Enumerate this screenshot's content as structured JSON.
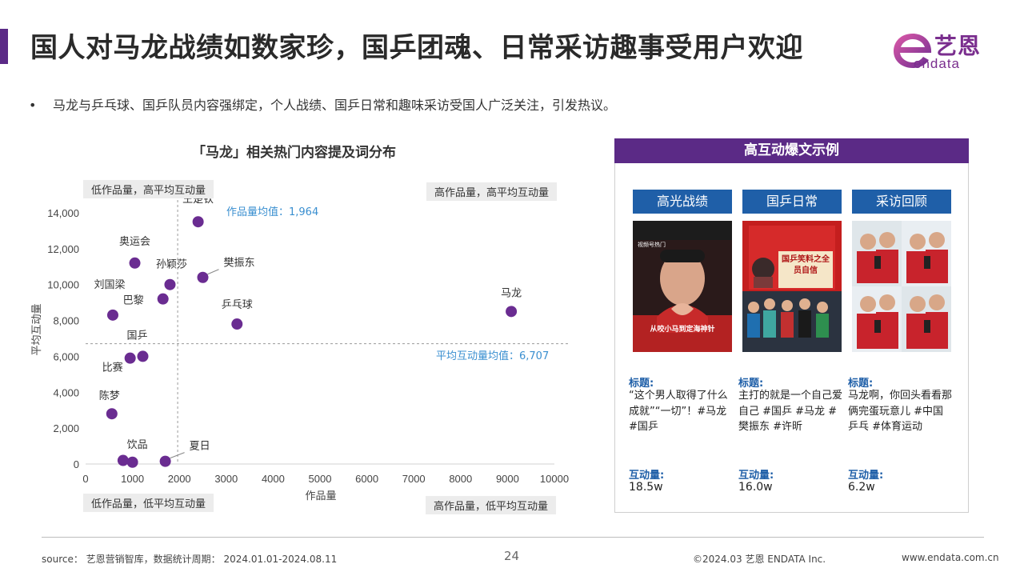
{
  "title": "国人对马龙战绩如数家珍，国乒团魂、日常采访趣事受用户欢迎",
  "logo": {
    "cn": "艺恩",
    "en": "endata"
  },
  "bullet": "马龙与乒乓球、国乒队员内容强绑定，个人战绩、国乒日常和趣味采访受国人广泛关注，引发热议。",
  "chart_title": "「马龙」相关热门内容提及词分布",
  "quadrants": {
    "top_left": "低作品量，高平均互动量",
    "top_right": "高作品量，高平均互动量",
    "bottom_left": "低作品量，低平均互动量",
    "bottom_right": "高作品量，低平均互动量"
  },
  "mean_labels": {
    "x": "作品量均值：1,964",
    "y": "平均互动量均值：6,707"
  },
  "chart_data": {
    "type": "scatter",
    "xlabel": "作品量",
    "ylabel": "平均互动量",
    "xlim": [
      0,
      10000
    ],
    "ylim": [
      0,
      14000
    ],
    "x_ticks": [
      0,
      1000,
      2000,
      3000,
      4000,
      5000,
      6000,
      7000,
      8000,
      9000,
      10000
    ],
    "y_ticks": [
      0,
      2000,
      4000,
      6000,
      8000,
      10000,
      12000,
      14000
    ],
    "x_tick_labels": [
      "0",
      "1000",
      "2000",
      "3000",
      "4000",
      "5000",
      "6000",
      "7000",
      "8000",
      "9000",
      "10000"
    ],
    "y_tick_labels": [
      "0",
      "2,000",
      "4,000",
      "6,000",
      "8,000",
      "10,000",
      "12,000",
      "14,000"
    ],
    "x_mean": 1964,
    "y_mean": 6707,
    "point_color": "#6a2c91",
    "points": [
      {
        "label": "王楚钦",
        "x": 2400,
        "y": 13500
      },
      {
        "label": "奥运会",
        "x": 1050,
        "y": 11200
      },
      {
        "label": "孙颖莎",
        "x": 1800,
        "y": 10000
      },
      {
        "label": "樊振东",
        "x": 2500,
        "y": 10400
      },
      {
        "label": "刘国梁",
        "x": 580,
        "y": 8300
      },
      {
        "label": "巴黎",
        "x": 1650,
        "y": 9200
      },
      {
        "label": "乒乓球",
        "x": 3230,
        "y": 7800
      },
      {
        "label": "马龙",
        "x": 9080,
        "y": 8500
      },
      {
        "label": "国乒",
        "x": 1220,
        "y": 6000
      },
      {
        "label": "比赛",
        "x": 950,
        "y": 5900
      },
      {
        "label": "陈梦",
        "x": 560,
        "y": 2800
      },
      {
        "label": "饮品",
        "x": 1000,
        "y": 100
      },
      {
        "label": "",
        "x": 800,
        "y": 200
      },
      {
        "label": "夏日",
        "x": 1700,
        "y": 150
      }
    ]
  },
  "panel": {
    "header": "高互动爆文示例",
    "title_label": "标题:",
    "interaction_label": "互动量:",
    "columns": [
      {
        "tab": "高光战绩",
        "thumb_caption": "从咬小马到定海神针",
        "thumb_tag": "视频号热门",
        "title": "“这个男人取得了什么成就”“一切”！#马龙 #国乒",
        "interaction": "18.5w"
      },
      {
        "tab": "国乒日常",
        "thumb_caption": "国乒笑料之全员自信",
        "title": "主打的就是一个自己爱自己 #国乒 #马龙 #樊振东 #许昕",
        "interaction": "16.0w"
      },
      {
        "tab": "采访回顾",
        "title": "马龙啊，你回头看看那俩完蛋玩意儿 #中国乒乓 #体育运动",
        "interaction": "6.2w"
      }
    ]
  },
  "footer": {
    "source": "source： 艺恩营销智库，数据统计周期： 2024.01.01-2024.08.11",
    "page": "24",
    "copyright": "©2024.03  艺恩 ENDATA Inc.",
    "url": "www.endata.com.cn"
  }
}
